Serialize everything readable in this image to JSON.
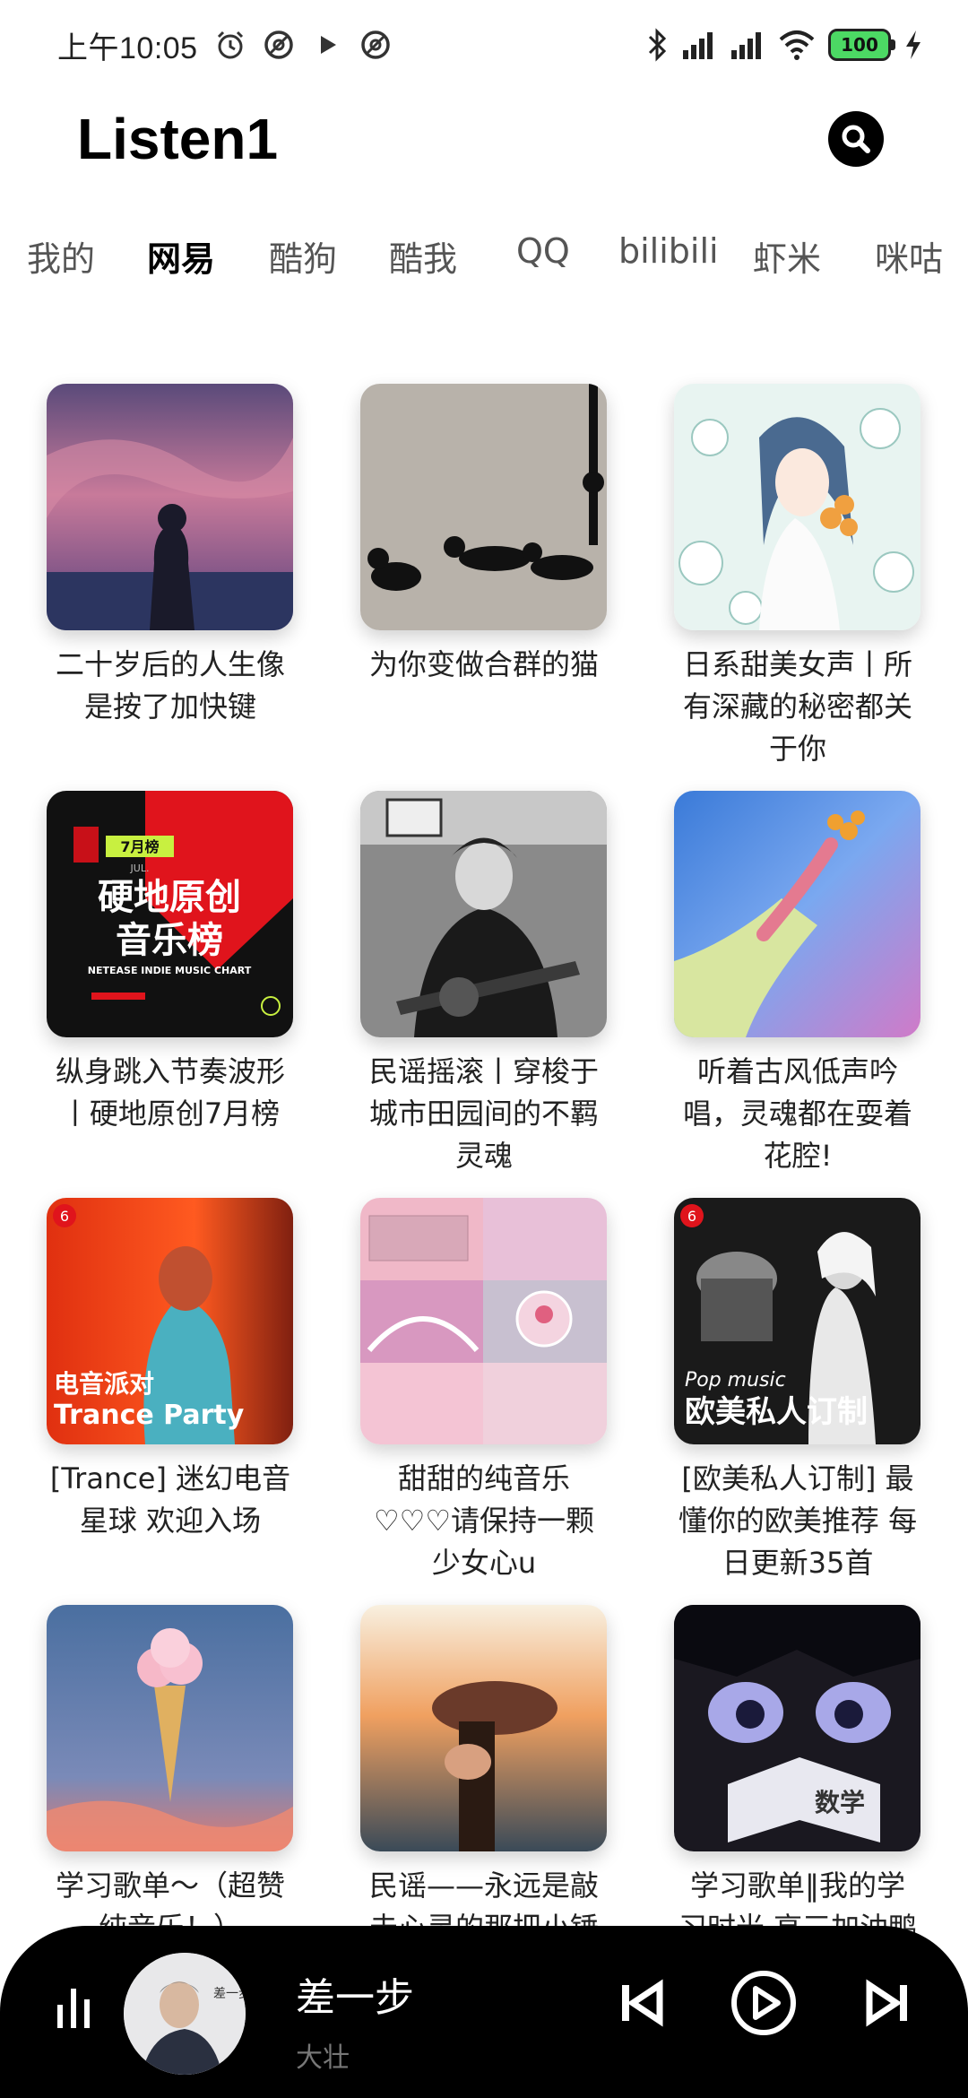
{
  "status_bar": {
    "time": "上午10:05",
    "battery": "100"
  },
  "app": {
    "title": "Listen1"
  },
  "tabs": [
    {
      "label": "我的"
    },
    {
      "label": "网易"
    },
    {
      "label": "酷狗"
    },
    {
      "label": "酷我"
    },
    {
      "label": "QQ"
    },
    {
      "label": "bilibili"
    },
    {
      "label": "虾米"
    },
    {
      "label": "咪咕"
    }
  ],
  "active_tab": "网易",
  "playlists": [
    {
      "title_lines": [
        "二十岁后的人生像",
        "是按了加快键"
      ]
    },
    {
      "title_lines": [
        "为你变做合群的猫"
      ]
    },
    {
      "title_lines": [
        "日系甜美女声丨所",
        "有深藏的秘密都关",
        "于你"
      ]
    },
    {
      "title_lines": [
        "纵身跳入节奏波形",
        "丨硬地原创7月榜"
      ],
      "cover_text": [
        "硬地原创",
        "音乐榜",
        "NETEASE INDIE MUSIC CHART",
        "7月榜",
        "JUL."
      ]
    },
    {
      "title_lines": [
        "民谣摇滚丨穿梭于",
        "城市田园间的不羁",
        "灵魂"
      ]
    },
    {
      "title_lines": [
        "听着古风低声吟",
        "唱，灵魂都在耍着",
        "花腔!"
      ]
    },
    {
      "title_lines": [
        "[Trance] 迷幻电音",
        "星球 欢迎入场"
      ],
      "cover_text": [
        "电音派对",
        "Trance Party"
      ]
    },
    {
      "title_lines": [
        "甜甜的纯音乐",
        "♡♡♡请保持一颗",
        "少女心u"
      ]
    },
    {
      "title_lines": [
        "[欧美私人订制] 最",
        "懂你的欧美推荐 每",
        "日更新35首"
      ],
      "cover_text": [
        "Pop music",
        "欧美私人订制"
      ]
    },
    {
      "title_lines": [
        "学习歌单～（超赞",
        "纯音乐！）"
      ]
    },
    {
      "title_lines": [
        "民谣——永远是敲",
        "击心灵的那把小锤"
      ]
    },
    {
      "title_lines": [
        "学习歌单‖我的学",
        "习时光 高三加油鸭"
      ],
      "cover_text": [
        "数学"
      ]
    }
  ],
  "player": {
    "song_title": "差一步",
    "artist": "大壮",
    "album_text": "差一步"
  },
  "colors": {
    "player_bg": "#000000",
    "accent": "#000000",
    "battery": "#4cd964"
  }
}
